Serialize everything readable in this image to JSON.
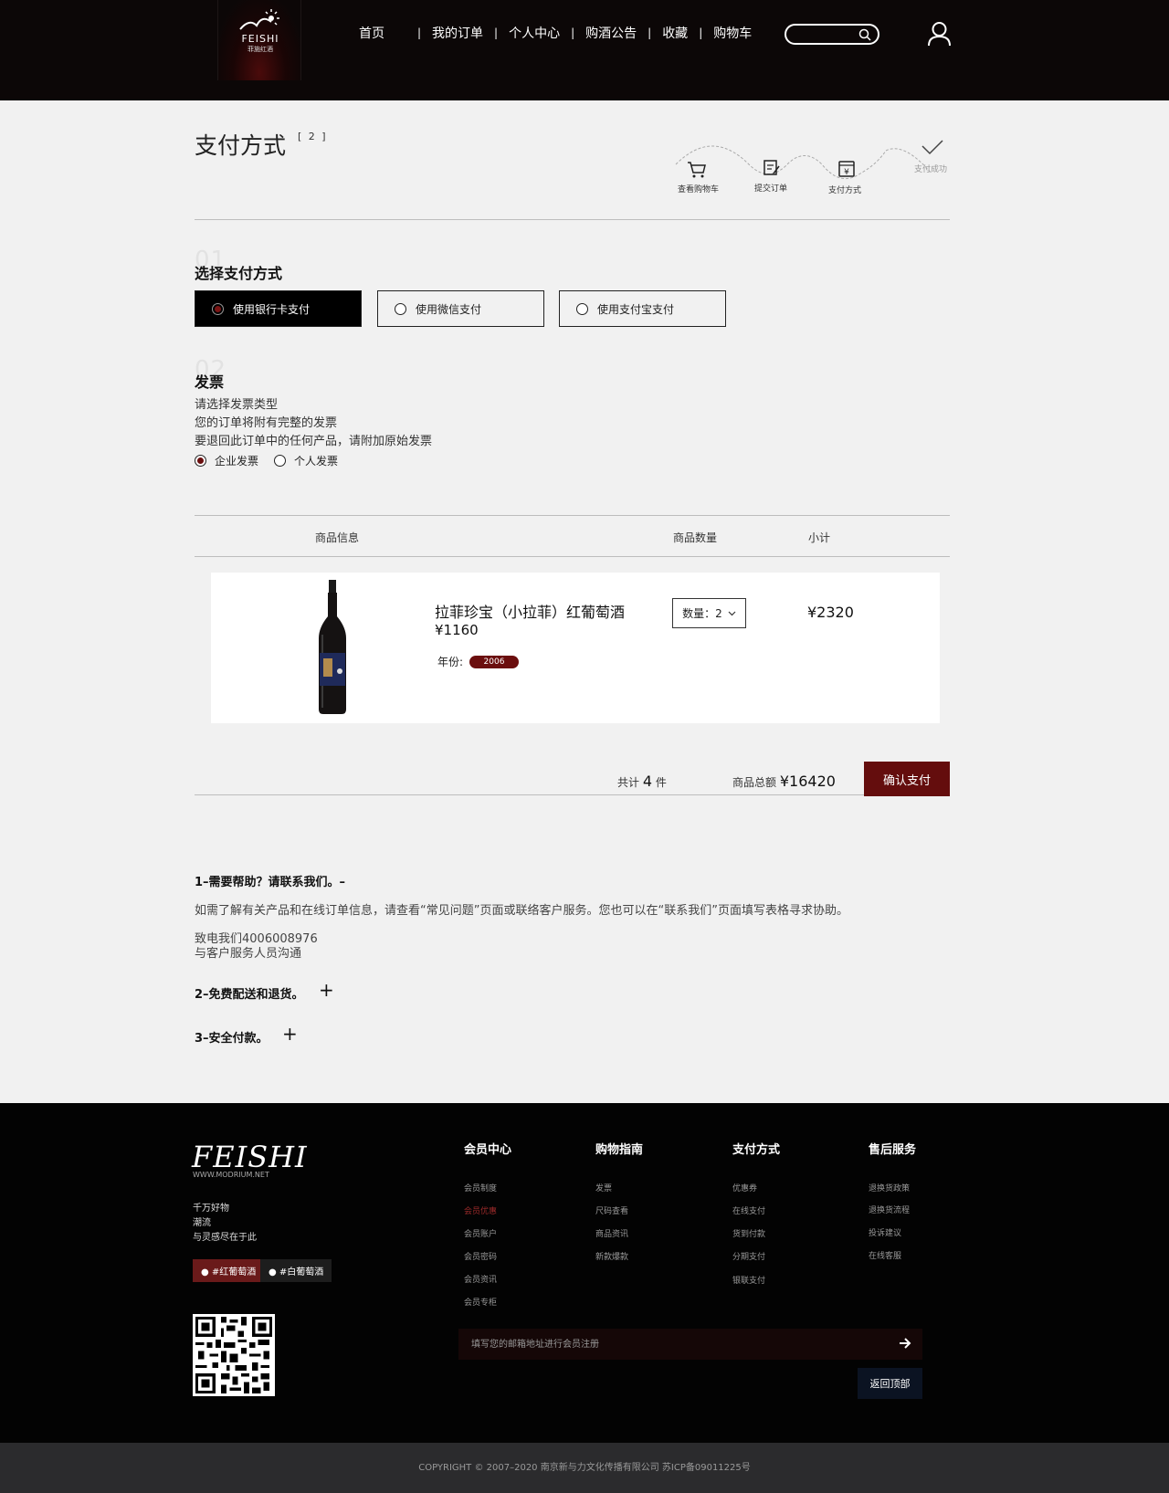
{
  "header": {
    "logo_text": "FEISHI",
    "logo_sub": "菲施红酒",
    "nav": [
      "首页",
      "我的订单",
      "个人中心",
      "购酒公告",
      "收藏",
      "购物车"
    ]
  },
  "page": {
    "title": "支付方式",
    "step": "[ 2 ]"
  },
  "progress": {
    "steps": [
      "查看购物车",
      "提交订单",
      "支付方式",
      "支付成功"
    ]
  },
  "payment": {
    "num": "01",
    "title": "选择支付方式",
    "options": [
      "使用银行卡支付",
      "使用微信支付",
      "使用支付宝支付"
    ],
    "selected": 0
  },
  "invoice": {
    "num": "02",
    "title": "发票",
    "lines": [
      "请选择发票类型",
      "您的订单将附有完整的发票",
      "要退回此订单中的任何产品，请附加原始发票"
    ],
    "options": [
      "企业发票",
      "个人发票"
    ],
    "selected": 0
  },
  "table": {
    "headers": [
      "商品信息",
      "商品数量",
      "小计"
    ]
  },
  "item": {
    "name": "拉菲珍宝（小拉菲）红葡萄酒",
    "price": "¥1160",
    "year_label": "年份:",
    "year": "2006",
    "qty": "数量：2",
    "subtotal": "¥2320"
  },
  "summary": {
    "count_prefix": "共计",
    "count": "4",
    "count_suffix": "件",
    "total_label": "商品总额",
    "total": "¥16420",
    "confirm": "确认支付"
  },
  "help": {
    "h1": "1–需要帮助？请联系我们。–",
    "p1": "如需了解有关产品和在线订单信息，请查看“常见问题”页面或联络客户服务。您也可以在“联系我们”页面填写表格寻求协助。",
    "phone": "致电我们4006008976",
    "phone_sub": "与客户服务人员沟通",
    "h2": "2–免费配送和退货。",
    "h3": "3–安全付款。"
  },
  "footer": {
    "logo": "FEISHI",
    "logo_sub": "WWW.MODRIUM.NET",
    "slogans": [
      "千万好物",
      "潮流",
      "与灵感尽在于此"
    ],
    "tags": [
      "● #红葡萄酒",
      "● #白葡萄酒"
    ],
    "columns": [
      {
        "title": "会员中心",
        "links": [
          "会员制度",
          "会员优惠",
          "会员账户",
          "会员密码",
          "会员资讯",
          "会员专柜"
        ]
      },
      {
        "title": "购物指南",
        "links": [
          "发票",
          "尺码查看",
          "商品资讯",
          "新款爆款"
        ]
      },
      {
        "title": "支付方式",
        "links": [
          "优惠券",
          "在线支付",
          "货到付款",
          "分期支付",
          "银联支付"
        ]
      },
      {
        "title": "售后服务",
        "links": [
          "退换货政策",
          "退换货流程",
          "投诉建议",
          "在线客服"
        ]
      }
    ],
    "subscribe_placeholder": "填写您的邮箱地址进行会员注册",
    "back_top": "返回顶部",
    "copyright": "COPYRIGHT © 2007–2020 南京新与力文化传播有限公司 苏ICP备09011225号"
  },
  "colors": {
    "header_bg": "#0c0707",
    "accent": "#640d0d",
    "footer_bg": "#030303",
    "copyright_bg": "#2b2b2d"
  }
}
